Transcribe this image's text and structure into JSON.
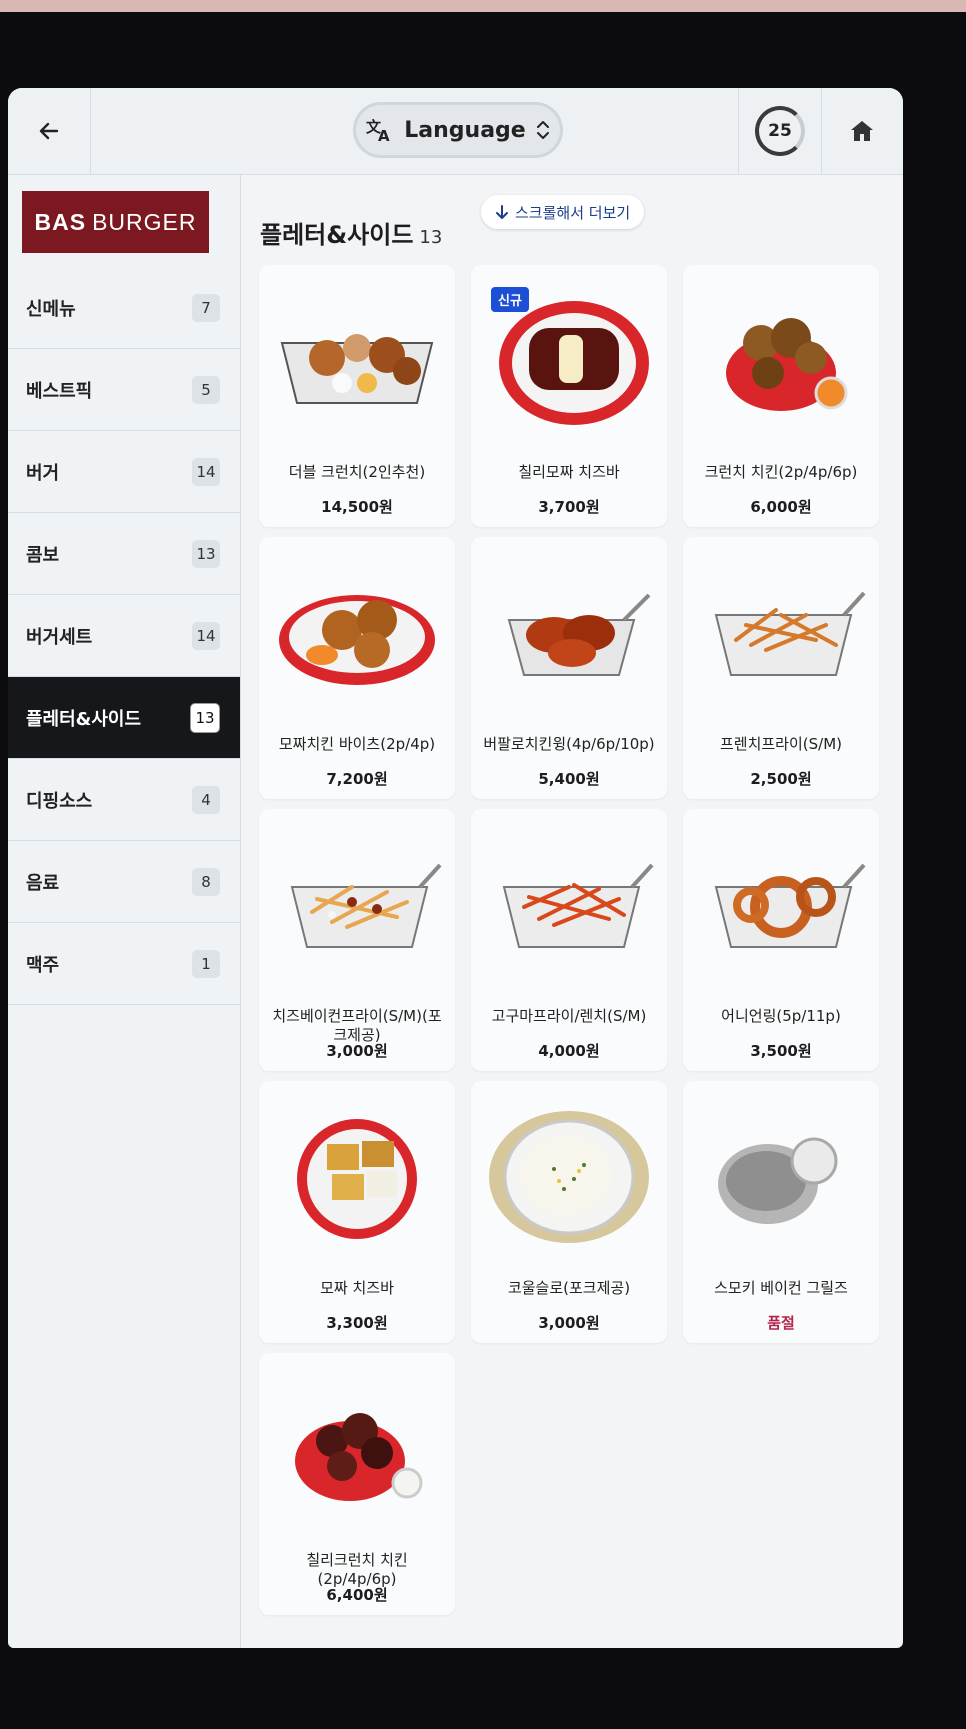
{
  "header": {
    "language_label": "Language",
    "timer_value": "25"
  },
  "brand": {
    "bold": "BAS",
    "rest": "BURGER"
  },
  "sidebar": {
    "items": [
      {
        "label": "신메뉴",
        "count": "7"
      },
      {
        "label": "베스트픽",
        "count": "5"
      },
      {
        "label": "버거",
        "count": "14"
      },
      {
        "label": "콤보",
        "count": "13"
      },
      {
        "label": "버거세트",
        "count": "14"
      },
      {
        "label": "플레터&사이드",
        "count": "13",
        "active": true
      },
      {
        "label": "디핑소스",
        "count": "4"
      },
      {
        "label": "음료",
        "count": "8"
      },
      {
        "label": "맥주",
        "count": "1"
      }
    ]
  },
  "main": {
    "title": "플레터&사이드",
    "count": "13",
    "scroll_hint": "스크롤해서 더보기",
    "products": [
      {
        "name": "더블 크런치(2인추천)",
        "price": "14,500원"
      },
      {
        "name": "칠리모짜 치즈바",
        "price": "3,700원",
        "badge": "신규"
      },
      {
        "name": "크런치 치킨(2p/4p/6p)",
        "price": "6,000원"
      },
      {
        "name": "모짜치킨 바이츠(2p/4p)",
        "price": "7,200원"
      },
      {
        "name": "버팔로치킨윙(4p/6p/10p)",
        "price": "5,400원"
      },
      {
        "name": "프렌치프라이(S/M)",
        "price": "2,500원"
      },
      {
        "name": "치즈베이컨프라이(S/M)(포크제공)",
        "price": "3,000원"
      },
      {
        "name": "고구마프라이/렌치(S/M)",
        "price": "4,000원"
      },
      {
        "name": "어니언링(5p/11p)",
        "price": "3,500원"
      },
      {
        "name": "모짜 치즈바",
        "price": "3,300원"
      },
      {
        "name": "코울슬로(포크제공)",
        "price": "3,000원"
      },
      {
        "name": "스모키 베이컨 그릴즈",
        "price": "품절",
        "soldout": true
      },
      {
        "name": "칠리크런치 치킨(2p/4p/6p)",
        "price": "6,400원"
      }
    ]
  },
  "colors": {
    "brand": "#7b1820",
    "active_category": "#15171a",
    "badge_new": "#1d4fd6",
    "soldout": "#b4234a"
  }
}
